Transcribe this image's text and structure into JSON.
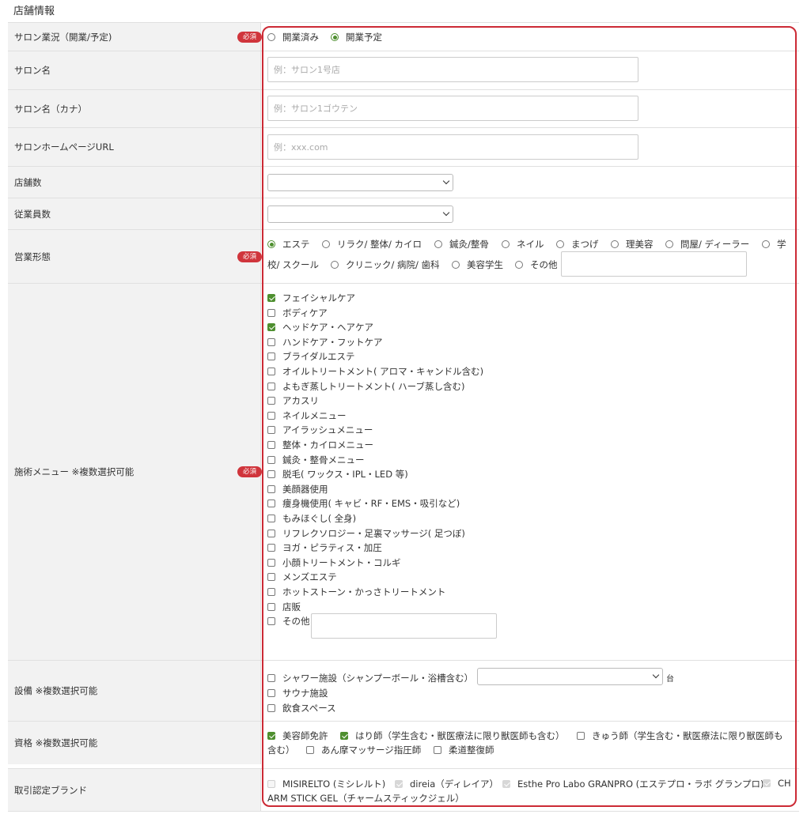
{
  "page": {
    "section_title": "店舗情報"
  },
  "badges": {
    "required": "必須"
  },
  "status": {
    "label": "サロン業況（開業/予定)",
    "options": [
      {
        "label": "開業済み",
        "selected": false
      },
      {
        "label": "開業予定",
        "selected": true
      }
    ]
  },
  "salon_name": {
    "label": "サロン名",
    "placeholder": "例：サロン1号店"
  },
  "salon_kana": {
    "label": "サロン名（カナ）",
    "placeholder": "例：サロン1ゴウテン"
  },
  "salon_url": {
    "label": "サロンホームページURL",
    "placeholder": "例：xxx.com"
  },
  "store_count": {
    "label": "店舗数",
    "value": ""
  },
  "staff_count": {
    "label": "従業員数",
    "value": ""
  },
  "business_type": {
    "label": "営業形態",
    "options": [
      {
        "label": "エステ",
        "selected": true
      },
      {
        "label": "リラク/ 整体/ カイロ",
        "selected": false
      },
      {
        "label": "鍼灸/整骨",
        "selected": false
      },
      {
        "label": "ネイル",
        "selected": false
      },
      {
        "label": "まつげ",
        "selected": false
      },
      {
        "label": "理美容",
        "selected": false
      },
      {
        "label": "問屋/ ディーラー",
        "selected": false
      },
      {
        "label": "学",
        "selected": false
      },
      {
        "label": "校/ スクール",
        "selected": false
      },
      {
        "label": "クリニック/ 病院/ 歯科",
        "selected": false
      },
      {
        "label": "美容学生",
        "selected": false
      },
      {
        "label": "その他",
        "selected": false
      }
    ],
    "other_value": ""
  },
  "menu": {
    "label": "施術メニュー ※複数選択可能",
    "items": [
      {
        "label": "フェイシャルケア",
        "checked": true
      },
      {
        "label": "ボディケア",
        "checked": false
      },
      {
        "label": "ヘッドケア・ヘアケア",
        "checked": true
      },
      {
        "label": "ハンドケア・フットケア",
        "checked": false
      },
      {
        "label": "ブライダルエステ",
        "checked": false
      },
      {
        "label": "オイルトリートメント( アロマ・キャンドル含む)",
        "checked": false
      },
      {
        "label": "よもぎ蒸しトリートメント( ハーブ蒸し含む)",
        "checked": false
      },
      {
        "label": "アカスリ",
        "checked": false
      },
      {
        "label": "ネイルメニュー",
        "checked": false
      },
      {
        "label": "アイラッシュメニュー",
        "checked": false
      },
      {
        "label": "整体・カイロメニュー",
        "checked": false
      },
      {
        "label": "鍼灸・整骨メニュー",
        "checked": false
      },
      {
        "label": "脱毛( ワックス・IPL・LED 等)",
        "checked": false
      },
      {
        "label": "美顔器使用",
        "checked": false
      },
      {
        "label": "痩身機使用( キャビ・RF・EMS・吸引など)",
        "checked": false
      },
      {
        "label": "もみほぐし( 全身)",
        "checked": false
      },
      {
        "label": "リフレクソロジー・足裏マッサージ( 足つぼ)",
        "checked": false
      },
      {
        "label": "ヨガ・ピラティス・加圧",
        "checked": false
      },
      {
        "label": "小顔トリートメント・コルギ",
        "checked": false
      },
      {
        "label": "メンズエステ",
        "checked": false
      },
      {
        "label": "ホットストーン・かっさトリートメント",
        "checked": false
      },
      {
        "label": "店販",
        "checked": false
      },
      {
        "label": "その他",
        "checked": false
      }
    ],
    "other_value": ""
  },
  "facilities": {
    "label": "設備 ※複数選択可能",
    "items": [
      {
        "label": "シャワー施設（シャンプーボール・浴槽含む）",
        "checked": false
      },
      {
        "label": "サウナ施設",
        "checked": false
      },
      {
        "label": "飲食スペース",
        "checked": false
      }
    ],
    "unit": "台",
    "shower_count": ""
  },
  "qualifications": {
    "label": "資格 ※複数選択可能",
    "items": [
      {
        "label": "美容師免許",
        "checked": true
      },
      {
        "label": "はり師（学生含む・獣医療法に限り獣医師も含む）",
        "checked": true
      },
      {
        "label": "きゅう師（学生含む・獣医療法に限り獣医師も",
        "checked": false
      },
      {
        "label": "含む）",
        "checked": false
      },
      {
        "label": "あん摩マッサージ指圧師",
        "checked": false
      },
      {
        "label": "柔道整復師",
        "checked": false
      }
    ]
  },
  "brands": {
    "label": "取引認定ブランド",
    "items": [
      {
        "label": "MISIRELTO (ミシレルト)",
        "checked": false
      },
      {
        "label": "direia（ディレイア）",
        "checked": true
      },
      {
        "label": "Esthe Pro Labo GRANPRO (エステプロ・ラボ グランプロ)",
        "checked": true
      },
      {
        "label": "CH",
        "checked": true
      },
      {
        "label": "ARM STICK GEL（チャームスティックジェル）",
        "checked": false
      }
    ]
  },
  "colors": {
    "accent": "#4e8f2f",
    "badge": "#d0353c",
    "highlight": "#cc2a35",
    "label_bg": "#f2f2f2"
  }
}
